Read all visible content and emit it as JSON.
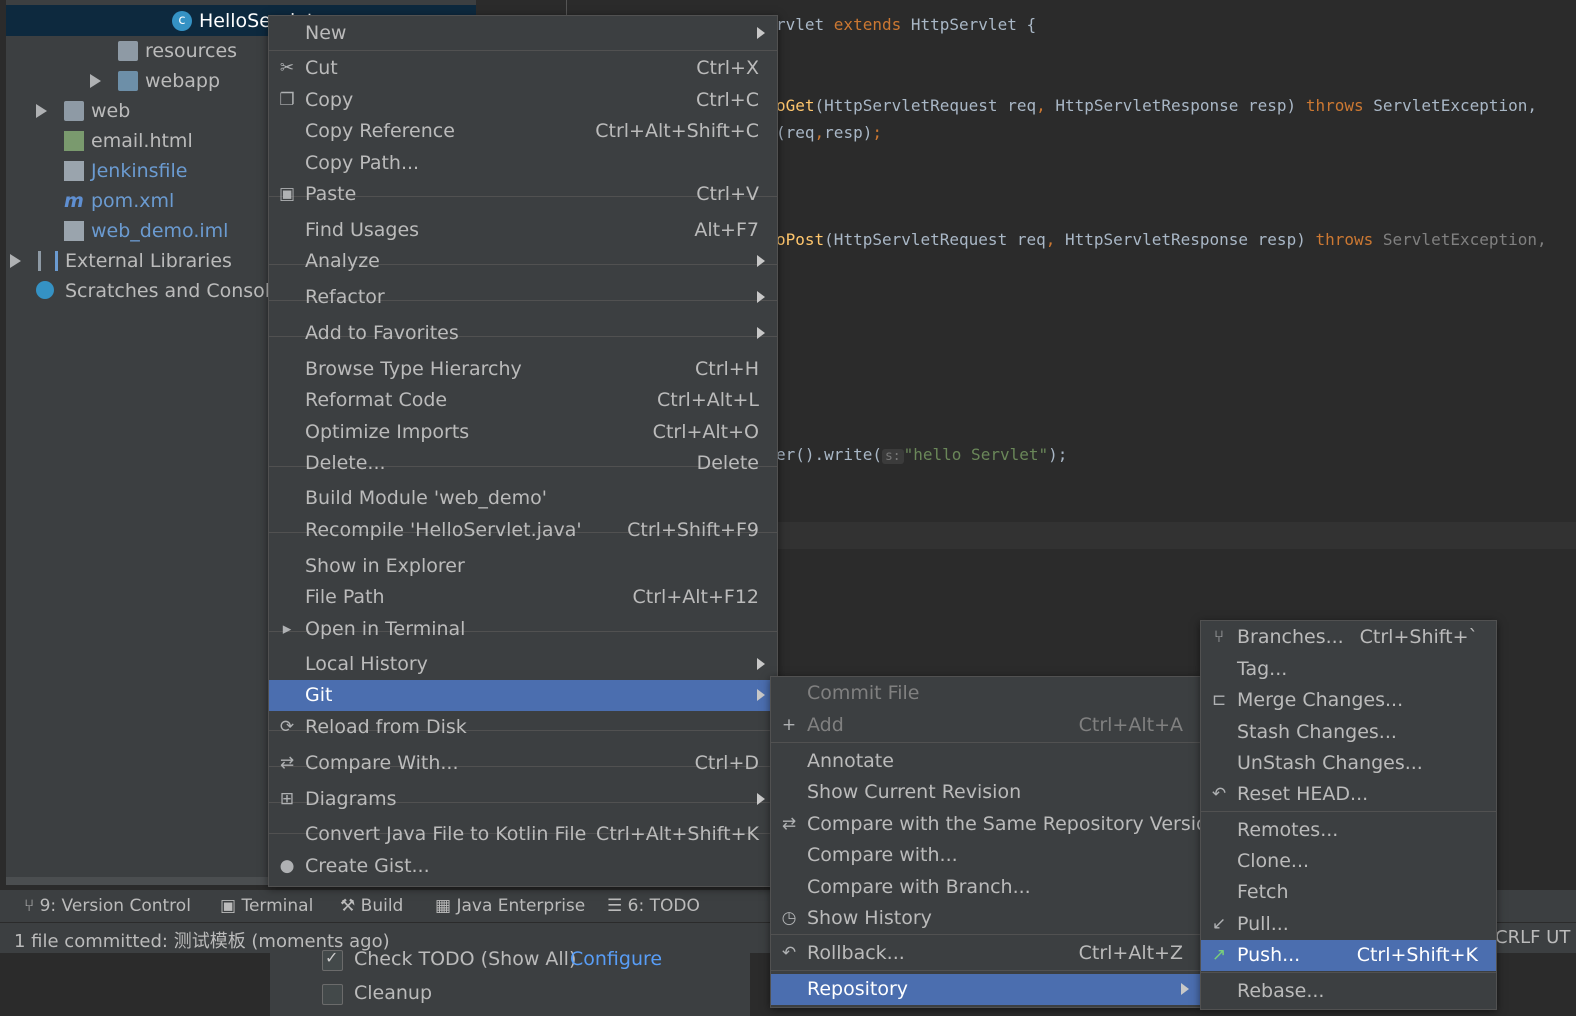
{
  "tree": {
    "items": [
      {
        "label": "HelloServlet",
        "badge": "c"
      },
      {
        "label": "resources"
      },
      {
        "label": "webapp"
      },
      {
        "label": "web"
      },
      {
        "label": "email.html"
      },
      {
        "label": "Jenkinsfile"
      },
      {
        "label": "pom.xml",
        "icon_text": "m"
      },
      {
        "label": "web_demo.iml"
      },
      {
        "label": "External Libraries"
      },
      {
        "label": "Scratches and Consoles"
      }
    ]
  },
  "editor": {
    "line1": {
      "a": "rvlet ",
      "b": "extends",
      "c": " HttpServlet {"
    },
    "line2": {
      "a": "oGet",
      "b": "(HttpServletRequest req",
      "c": ",",
      "d": " HttpServletResponse resp) ",
      "e": "throws",
      "f": " ServletException,"
    },
    "line3": {
      "a": "(req",
      "b": ",",
      "c": "resp)",
      "d": ";"
    },
    "line4": {
      "a": "oPost",
      "b": "(HttpServletRequest req",
      "c": ",",
      "d": " HttpServletResponse resp) ",
      "e": "throws",
      "f": " ServletException,"
    },
    "line5": {
      "a": "er().write(",
      "hint": "s:",
      "b": "\"hello Servlet\"",
      "c": ");"
    }
  },
  "main_menu": {
    "items": [
      {
        "label": "New",
        "shortcut": "",
        "submenu": true
      },
      {
        "label": "Cut",
        "shortcut": "Ctrl+X",
        "icon": "scissors-icon",
        "glyph": "✂"
      },
      {
        "label": "Copy",
        "shortcut": "Ctrl+C",
        "icon": "copy-icon",
        "glyph": "❐"
      },
      {
        "label": "Copy Reference",
        "shortcut": "Ctrl+Alt+Shift+C"
      },
      {
        "label": "Copy Path...",
        "shortcut": ""
      },
      {
        "label": "Paste",
        "shortcut": "Ctrl+V",
        "icon": "clipboard-icon",
        "glyph": "▣"
      },
      {
        "label": "Find Usages",
        "shortcut": "Alt+F7"
      },
      {
        "label": "Analyze",
        "shortcut": "",
        "submenu": true
      },
      {
        "label": "Refactor",
        "shortcut": "",
        "submenu": true
      },
      {
        "label": "Add to Favorites",
        "shortcut": "",
        "submenu": true
      },
      {
        "label": "Browse Type Hierarchy",
        "shortcut": "Ctrl+H"
      },
      {
        "label": "Reformat Code",
        "shortcut": "Ctrl+Alt+L"
      },
      {
        "label": "Optimize Imports",
        "shortcut": "Ctrl+Alt+O"
      },
      {
        "label": "Delete...",
        "shortcut": "Delete"
      },
      {
        "label": "Build Module 'web_demo'",
        "shortcut": ""
      },
      {
        "label": "Recompile 'HelloServlet.java'",
        "shortcut": "Ctrl+Shift+F9"
      },
      {
        "label": "Show in Explorer",
        "shortcut": ""
      },
      {
        "label": "File Path",
        "shortcut": "Ctrl+Alt+F12"
      },
      {
        "label": "Open in Terminal",
        "shortcut": "",
        "icon": "terminal-icon",
        "glyph": "▸"
      },
      {
        "label": "Local History",
        "shortcut": "",
        "submenu": true
      },
      {
        "label": "Git",
        "shortcut": "",
        "submenu": true
      },
      {
        "label": "Reload from Disk",
        "shortcut": "",
        "icon": "reload-icon",
        "glyph": "⟳"
      },
      {
        "label": "Compare With...",
        "shortcut": "Ctrl+D",
        "icon": "compare-icon",
        "glyph": "⇄"
      },
      {
        "label": "Diagrams",
        "shortcut": "",
        "submenu": true,
        "icon": "diagram-icon",
        "glyph": "⊞"
      },
      {
        "label": "Convert Java File to Kotlin File",
        "shortcut": "Ctrl+Alt+Shift+K"
      },
      {
        "label": "Create Gist...",
        "shortcut": "",
        "icon": "github-icon",
        "glyph": "●"
      }
    ]
  },
  "git_menu": {
    "items": [
      {
        "label": "Commit File",
        "shortcut": ""
      },
      {
        "label": "Add",
        "shortcut": "Ctrl+Alt+A",
        "glyph": "+"
      },
      {
        "label": "Annotate",
        "shortcut": ""
      },
      {
        "label": "Show Current Revision",
        "shortcut": ""
      },
      {
        "label": "Compare with the Same Repository Version",
        "shortcut": "",
        "glyph": "⇄"
      },
      {
        "label": "Compare with...",
        "shortcut": ""
      },
      {
        "label": "Compare with Branch...",
        "shortcut": ""
      },
      {
        "label": "Show History",
        "shortcut": "",
        "glyph": "◷"
      },
      {
        "label": "Rollback...",
        "shortcut": "Ctrl+Alt+Z",
        "glyph": "↶"
      },
      {
        "label": "Repository",
        "shortcut": "",
        "submenu": true
      }
    ]
  },
  "repo_menu": {
    "items": [
      {
        "label": "Branches...",
        "shortcut": "Ctrl+Shift+`",
        "glyph": "⑂"
      },
      {
        "label": "Tag...",
        "shortcut": ""
      },
      {
        "label": "Merge Changes...",
        "shortcut": "",
        "glyph": "⊏"
      },
      {
        "label": "Stash Changes...",
        "shortcut": ""
      },
      {
        "label": "UnStash Changes...",
        "shortcut": ""
      },
      {
        "label": "Reset HEAD...",
        "shortcut": "",
        "glyph": "↶"
      },
      {
        "label": "Remotes...",
        "shortcut": ""
      },
      {
        "label": "Clone...",
        "shortcut": ""
      },
      {
        "label": "Fetch",
        "shortcut": ""
      },
      {
        "label": "Pull...",
        "shortcut": "",
        "glyph": "↙"
      },
      {
        "label": "Push...",
        "shortcut": "Ctrl+Shift+K",
        "glyph": "↗"
      },
      {
        "label": "Rebase...",
        "shortcut": ""
      }
    ]
  },
  "toolbar": {
    "version_control": "9: Version Control",
    "terminal": "Terminal",
    "build": "Build",
    "java_enterprise": "Java Enterprise",
    "todo": "6: TODO"
  },
  "status": {
    "message": "1 file committed: 测试模板 (moments ago)",
    "crlf": "CRLF  UT"
  },
  "commit_dialog": {
    "check_todo": "Check TODO (Show All)",
    "configure": "Configure",
    "cleanup": "Cleanup"
  },
  "colors": {
    "highlight": "#4b6eaf",
    "menu_bg": "#3c3f41",
    "editor_bg": "#2b2b2b",
    "keyword": "#cc7832",
    "link": "#589df6"
  }
}
